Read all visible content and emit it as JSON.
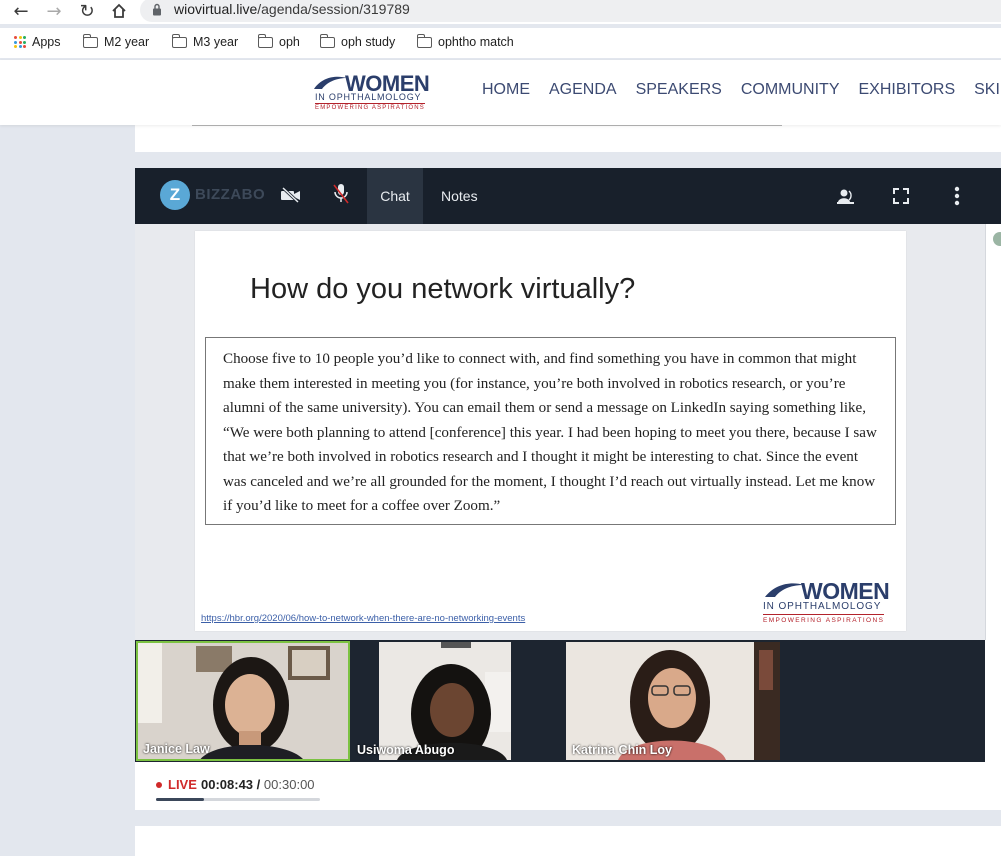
{
  "browser": {
    "url_domain": "wiovirtual.live",
    "url_path": "/agenda/session/319789",
    "bookmarks": [
      {
        "label": "Apps"
      },
      {
        "label": "M2 year"
      },
      {
        "label": "M3 year"
      },
      {
        "label": "oph"
      },
      {
        "label": "oph study"
      },
      {
        "label": "ophtho match"
      }
    ]
  },
  "site": {
    "logo_main": "WOMEN",
    "logo_sub": "IN OPHTHALMOLOGY",
    "logo_tagline": "EMPOWERING ASPIRATIONS",
    "nav": [
      "HOME",
      "AGENDA",
      "SPEAKERS",
      "COMMUNITY",
      "EXHIBITORS",
      "SKILL"
    ]
  },
  "player": {
    "brand": "BIZZABO",
    "brand_letter": "Z",
    "tabs": {
      "chat": "Chat",
      "notes": "Notes"
    },
    "slide": {
      "title": "How do you network virtually?",
      "quote": "Choose five to 10 people you’d like to connect with, and find something you have in common that might make them interested in meeting you (for instance, you’re both involved in robotics research, or you’re alumni of the same university). You can email them or send a message on LinkedIn saying something like, “We were both planning to attend [conference] this year. I had been hoping to meet you there, because I saw that we’re both involved in robotics research and I thought it might be interesting to chat. Since the event was canceled and we’re all grounded for the moment, I thought I’d reach out virtually instead. Let me know if you’d like to meet for a coffee over Zoom.”",
      "link": "https://hbr.org/2020/06/how-to-network-when-there-are-no-networking-events",
      "logo_main": "WOMEN",
      "logo_sub": "IN OPHTHALMOLOGY",
      "logo_tagline": "EMPOWERING ASPIRATIONS"
    },
    "participants": [
      {
        "name": "Janice Law",
        "active": true
      },
      {
        "name": "Usiwoma Abugo",
        "active": false
      },
      {
        "name": "Katrina Chin Loy",
        "active": false
      }
    ],
    "live_label": "LIVE",
    "elapsed": "00:08:43",
    "separator": "/",
    "total": "00:30:00",
    "progress_fraction": 0.29
  },
  "colors": {
    "accent_live": "#d02a2a",
    "toolbar_bg": "#18202b",
    "nav_text": "#3c4a72",
    "active_speaker_border": "#7cc242"
  }
}
